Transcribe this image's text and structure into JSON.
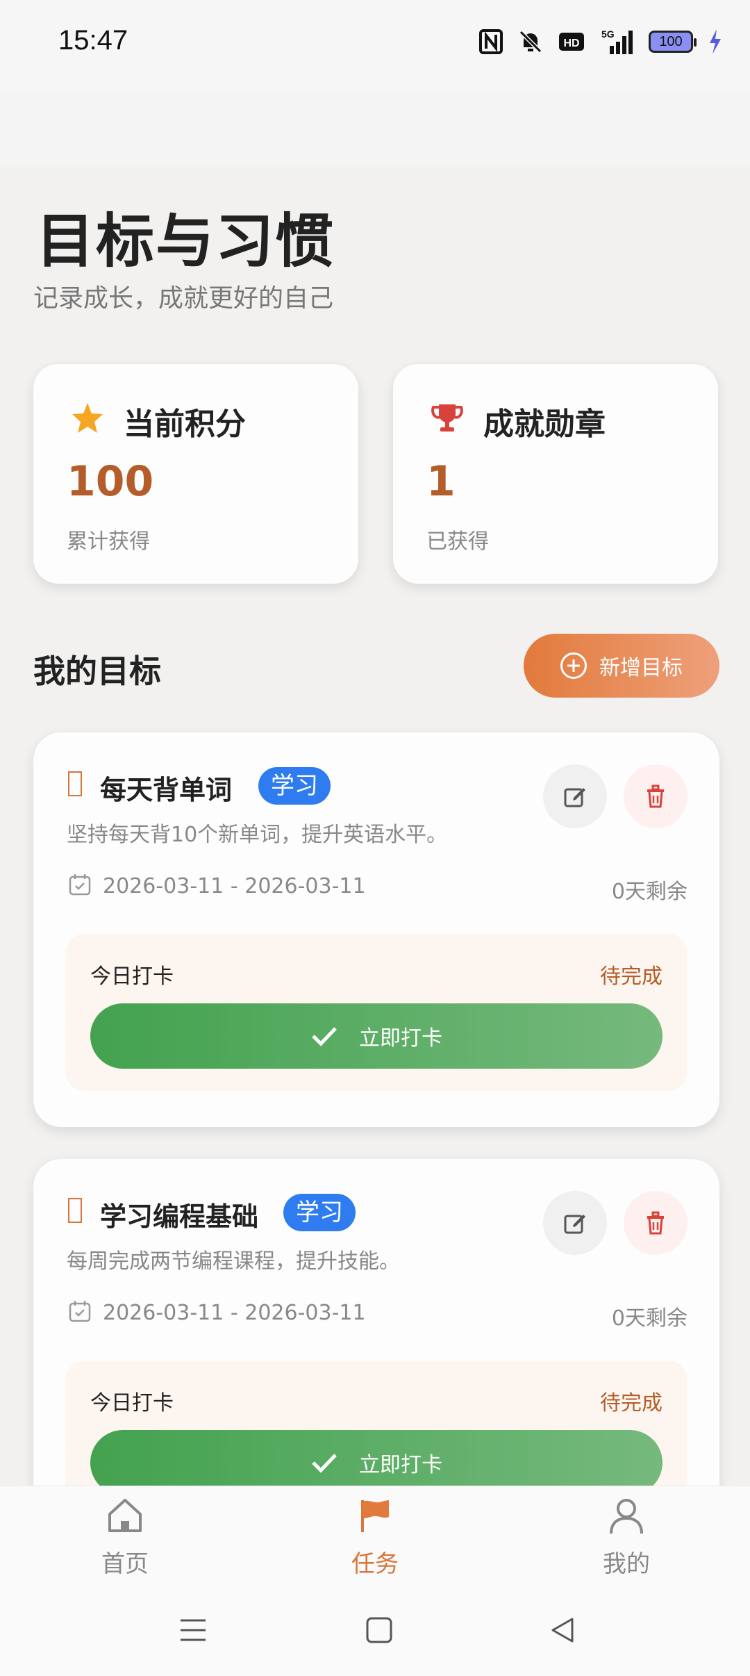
{
  "status_bar": {
    "time": "15:47",
    "battery": "100",
    "icons": [
      "nfc-icon",
      "mute-icon",
      "hd-icon",
      "5g-signal-icon",
      "battery-icon",
      "charging-icon"
    ]
  },
  "header": {
    "title": "目标与习惯",
    "subtitle": "记录成长，成就更好的自己"
  },
  "stats": {
    "points": {
      "title": "当前积分",
      "value": "100",
      "caption": "累计获得",
      "icon": "star-icon"
    },
    "badges": {
      "title": "成就勋章",
      "value": "1",
      "caption": "已获得",
      "icon": "trophy-icon"
    }
  },
  "goals_section": {
    "title": "我的目标",
    "add_button": "新增目标"
  },
  "goals": [
    {
      "name": "每天背单词",
      "tag": "学习",
      "description": "坚持每天背10个新单词，提升英语水平。",
      "dates": "2026-03-11 - 2026-03-11",
      "remaining": "0天剩余",
      "checkin_label": "今日打卡",
      "checkin_status": "待完成",
      "checkin_button": "立即打卡"
    },
    {
      "name": "学习编程基础",
      "tag": "学习",
      "description": "每周完成两节编程课程，提升技能。",
      "dates": "2026-03-11 - 2026-03-11",
      "remaining": "0天剩余",
      "checkin_label": "今日打卡",
      "checkin_status": "待完成",
      "checkin_button": "立即打卡"
    }
  ],
  "tabs": [
    {
      "label": "首页",
      "icon": "home-icon"
    },
    {
      "label": "任务",
      "icon": "flag-icon",
      "active": true
    },
    {
      "label": "我的",
      "icon": "person-icon"
    }
  ],
  "colors": {
    "accent": "#d6763a",
    "value": "#b45d2a",
    "green": "#43a24f",
    "tag_blue": "#2e7cf0"
  }
}
